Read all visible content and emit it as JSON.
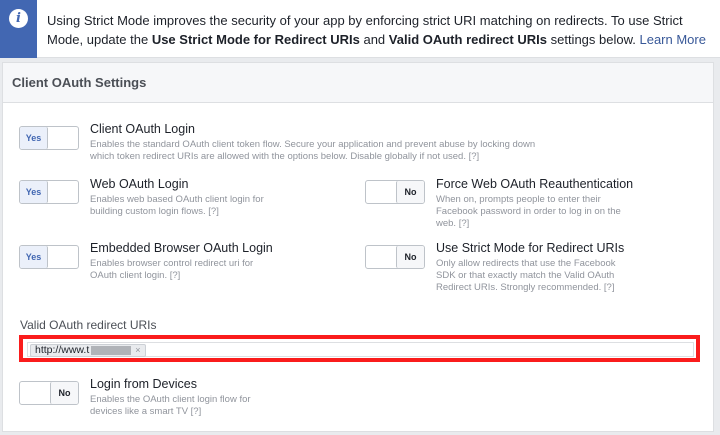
{
  "banner": {
    "icon": "info-icon",
    "text_1": "Using Strict Mode improves the security of your app by enforcing strict URI matching on redirects. To use Strict Mode, update the ",
    "bold_1": "Use Strict Mode for Redirect URIs",
    "text_2": " and ",
    "bold_2": "Valid OAuth redirect URIs",
    "text_3": " settings below. ",
    "link": "Learn More"
  },
  "panel": {
    "title": "Client OAuth Settings",
    "settings": {
      "client_oauth": {
        "toggle": "Yes",
        "title": "Client OAuth Login",
        "desc": "Enables the standard OAuth client token flow. Secure your application and prevent abuse by locking down which token redirect URIs are allowed with the options below. Disable globally if not used.  [?]"
      },
      "web_oauth": {
        "toggle": "Yes",
        "title": "Web OAuth Login",
        "desc": "Enables web based OAuth client login for building custom login flows.  [?]"
      },
      "force_reauth": {
        "toggle": "No",
        "title": "Force Web OAuth Reauthentication",
        "desc": "When on, prompts people to enter their Facebook password in order to log in on the web.  [?]"
      },
      "embedded_browser": {
        "toggle": "Yes",
        "title": "Embedded Browser OAuth Login",
        "desc": "Enables browser control redirect uri for OAuth client login.  [?]"
      },
      "strict_mode": {
        "toggle": "No",
        "title": "Use Strict Mode for Redirect URIs",
        "desc": "Only allow redirects that use the Facebook SDK or that exactly match the Valid OAuth Redirect URIs. Strongly recommended.  [?]"
      },
      "login_devices": {
        "toggle": "No",
        "title": "Login from Devices",
        "desc": "Enables the OAuth client login flow for devices like a smart TV  [?]"
      }
    },
    "redirect_uris": {
      "label": "Valid OAuth redirect URIs",
      "value": "http://www.t",
      "remove_glyph": "×"
    }
  }
}
